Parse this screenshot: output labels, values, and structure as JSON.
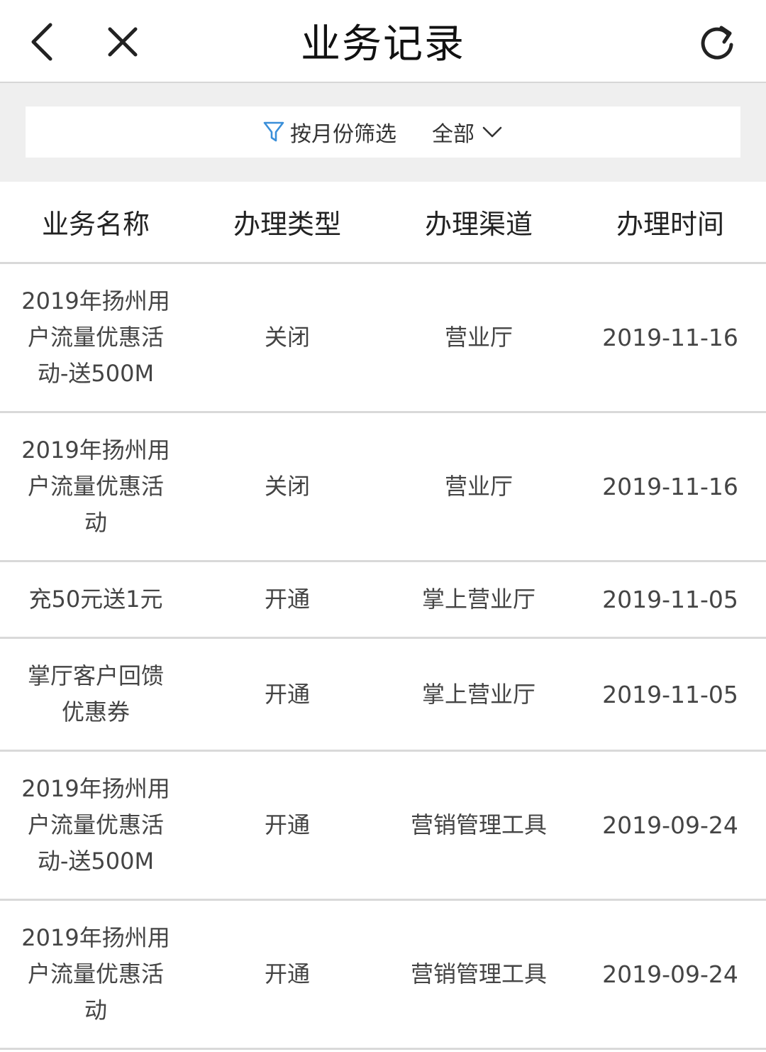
{
  "header": {
    "title": "业务记录",
    "back_icon": "chevron-left-icon",
    "close_icon": "close-icon",
    "refresh_icon": "refresh-icon"
  },
  "filter": {
    "label": "按月份筛选",
    "value": "全部",
    "icon": "filter-icon",
    "accent": "#3a8fd9"
  },
  "table": {
    "headers": [
      "业务名称",
      "办理类型",
      "办理渠道",
      "办理时间"
    ],
    "rows": [
      {
        "name": "2019年扬州用户流量优惠活动-送500M",
        "type": "关闭",
        "channel": "营业厅",
        "date": "2019-11-16"
      },
      {
        "name": "2019年扬州用户流量优惠活动",
        "type": "关闭",
        "channel": "营业厅",
        "date": "2019-11-16"
      },
      {
        "name": "充50元送1元",
        "type": "开通",
        "channel": "掌上营业厅",
        "date": "2019-11-05"
      },
      {
        "name": "掌厅客户回馈优惠券",
        "type": "开通",
        "channel": "掌上营业厅",
        "date": "2019-11-05"
      },
      {
        "name": "2019年扬州用户流量优惠活动-送500M",
        "type": "开通",
        "channel": "营销管理工具",
        "date": "2019-09-24"
      },
      {
        "name": "2019年扬州用户流量优惠活动",
        "type": "开通",
        "channel": "营销管理工具",
        "date": "2019-09-24"
      }
    ]
  }
}
